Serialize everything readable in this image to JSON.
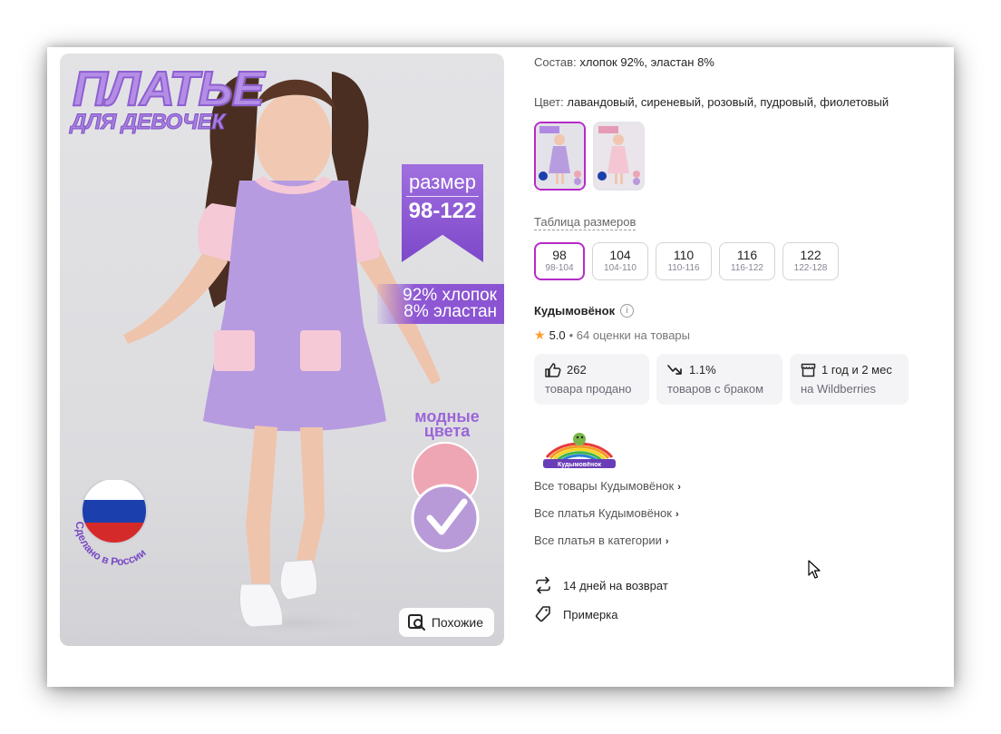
{
  "gallery": {
    "promo_title": "ПЛАТЬЕ",
    "promo_subtitle": "ДЛЯ ДЕВОЧЕК",
    "size_word": "размер",
    "size_range": "98-122",
    "fabric_line1": "92% хлопок",
    "fabric_line2": "8% эластан",
    "colors_line1": "модные",
    "colors_line2": "цвета",
    "made_in": "Сделано в России",
    "similar_button": "Похожие"
  },
  "product": {
    "composition_label": "Состав:",
    "composition_value": "хлопок 92%, эластан 8%",
    "color_label": "Цвет:",
    "color_value": "лавандовый, сиреневый, розовый, пудровый, фиолетовый",
    "size_table_link": "Таблица размеров",
    "sizes": [
      {
        "size": "98",
        "range": "98-104",
        "selected": true
      },
      {
        "size": "104",
        "range": "104-110",
        "selected": false
      },
      {
        "size": "110",
        "range": "110-116",
        "selected": false
      },
      {
        "size": "116",
        "range": "116-122",
        "selected": false
      },
      {
        "size": "122",
        "range": "122-128",
        "selected": false
      }
    ]
  },
  "seller": {
    "name": "Кудымовёнок",
    "info_icon": "info-icon",
    "rating": "5.0",
    "reviews": "• 64 оценки на товары",
    "stats": [
      {
        "icon": "thumbs-up-icon",
        "value": "262",
        "label": "товара продано"
      },
      {
        "icon": "trend-down-icon",
        "value": "1.1%",
        "label": "товаров с браком"
      },
      {
        "icon": "store-icon",
        "value": "1 год и 2 мес",
        "label": "на Wildberries"
      }
    ],
    "logo_text": "Кудымовёнок",
    "links": [
      "Все товары Кудымовёнок",
      "Все платья Кудымовёнок",
      "Все платья в категории"
    ]
  },
  "features": [
    {
      "icon": "return-arrows-icon",
      "label": "14 дней на возврат"
    },
    {
      "icon": "tag-icon",
      "label": "Примерка"
    }
  ],
  "colors": {
    "accent": "#b62ac7",
    "lavender": "#b89ce0",
    "pink": "#f4c6d4",
    "star": "#ff9e2c"
  }
}
